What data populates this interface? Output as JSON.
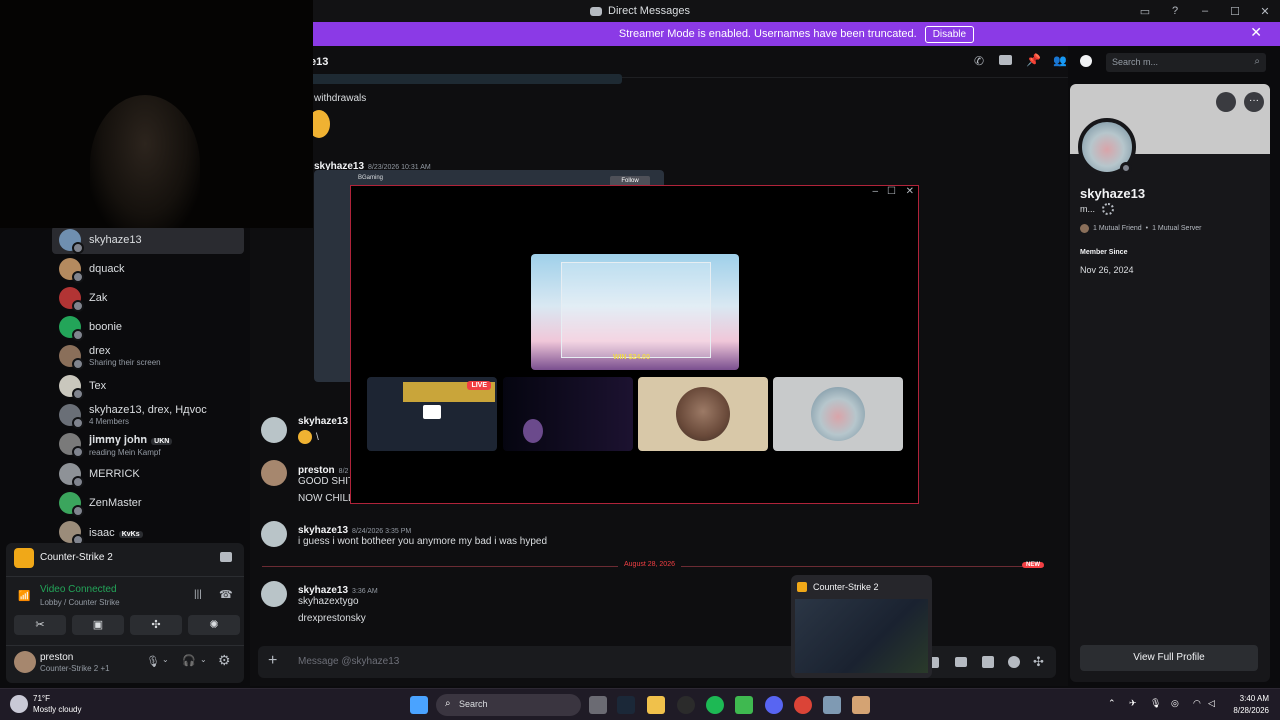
{
  "window": {
    "title": "Direct Messages"
  },
  "banner": {
    "text": "Streamer Mode is enabled. Usernames have been truncated.",
    "button": "Disable"
  },
  "chat_header": {
    "name": "e13",
    "search_placeholder": "Search m..."
  },
  "sidebar": {
    "items": [
      {
        "name": "skyhaze13",
        "sub": "",
        "color": "#6f8fb0"
      },
      {
        "name": "dquack",
        "sub": "",
        "color": "#b48a5f"
      },
      {
        "name": "Zak",
        "sub": "",
        "color": "#b23434"
      },
      {
        "name": "boonie",
        "sub": "",
        "color": "#23a559"
      },
      {
        "name": "drex",
        "sub": "Sharing their screen",
        "color": "#8a6f5a"
      },
      {
        "name": "Tex",
        "sub": "",
        "color": "#c9c7bd"
      },
      {
        "name": "skyhaze13, drex, Hдvoc",
        "sub": "4 Members",
        "color": "#6a6f77"
      },
      {
        "name": "𝐣𝐢𝐦𝐦𝐲 𝐣𝐨𝐡𝐧",
        "tag": "UKN",
        "sub": "reading Mein Kampf",
        "color": "#7a7a7a"
      },
      {
        "name": "MERRICK",
        "sub": "",
        "color": "#8e9297"
      },
      {
        "name": "ZenMaster",
        "sub": "",
        "color": "#3ba55d"
      },
      {
        "name": "isaac",
        "tag": "KvKs",
        "sub": "",
        "color": "#9b8c7a"
      }
    ]
  },
  "voice": {
    "game": "Counter-Strike 2",
    "status": "Video Connected",
    "channel": "Lobby / Counter Strike",
    "user": "preston",
    "user_sub": "Counter-Strike 2 +1"
  },
  "messages": {
    "top_text": "withdrawals",
    "embed_author": "skyhaze13",
    "embed_time": "8/23/2026 10:31 AM",
    "embed_title": "BGaming",
    "embed_follow": "Follow",
    "m1_name": "skyhaze13",
    "m1_text": "\\",
    "m2_name": "preston",
    "m2_time": "8/2",
    "m2_text1": "GOOD SHIT",
    "m2_text2": "NOW CHILL",
    "m3_name": "skyhaze13",
    "m3_time": "8/24/2026 3:35 PM",
    "m3_text": "i guess i wont botheer you anymore my bad i was hyped",
    "divider": "August 28, 2026",
    "new_badge": "NEW",
    "m4_name": "skyhaze13",
    "m4_time": "3:36 AM",
    "m4_text1": "skyhazextygo",
    "m4_text2": "drexprestonsky",
    "composer_placeholder": "Message @skyhaze13"
  },
  "popout": {
    "live_badge": "LIVE",
    "win_text": "WIN $24.00"
  },
  "preview": {
    "title": "Counter-Strike 2"
  },
  "profile": {
    "name": "skyhaze13",
    "status": "m...",
    "mutual_friends": "1 Mutual Friend",
    "mutual_servers": "1 Mutual Server",
    "member_since_label": "Member Since",
    "member_since": "Nov 26, 2024",
    "view_full": "View Full Profile"
  },
  "taskbar": {
    "weather_temp": "71°F",
    "weather_desc": "Mostly cloudy",
    "search": "Search",
    "time": "3:40 AM",
    "date": "8/28/2026"
  },
  "colors": {
    "accent": "#8b3ae6",
    "green": "#23a559",
    "popout_border": "#b0233a",
    "new_red": "#f23f43"
  }
}
